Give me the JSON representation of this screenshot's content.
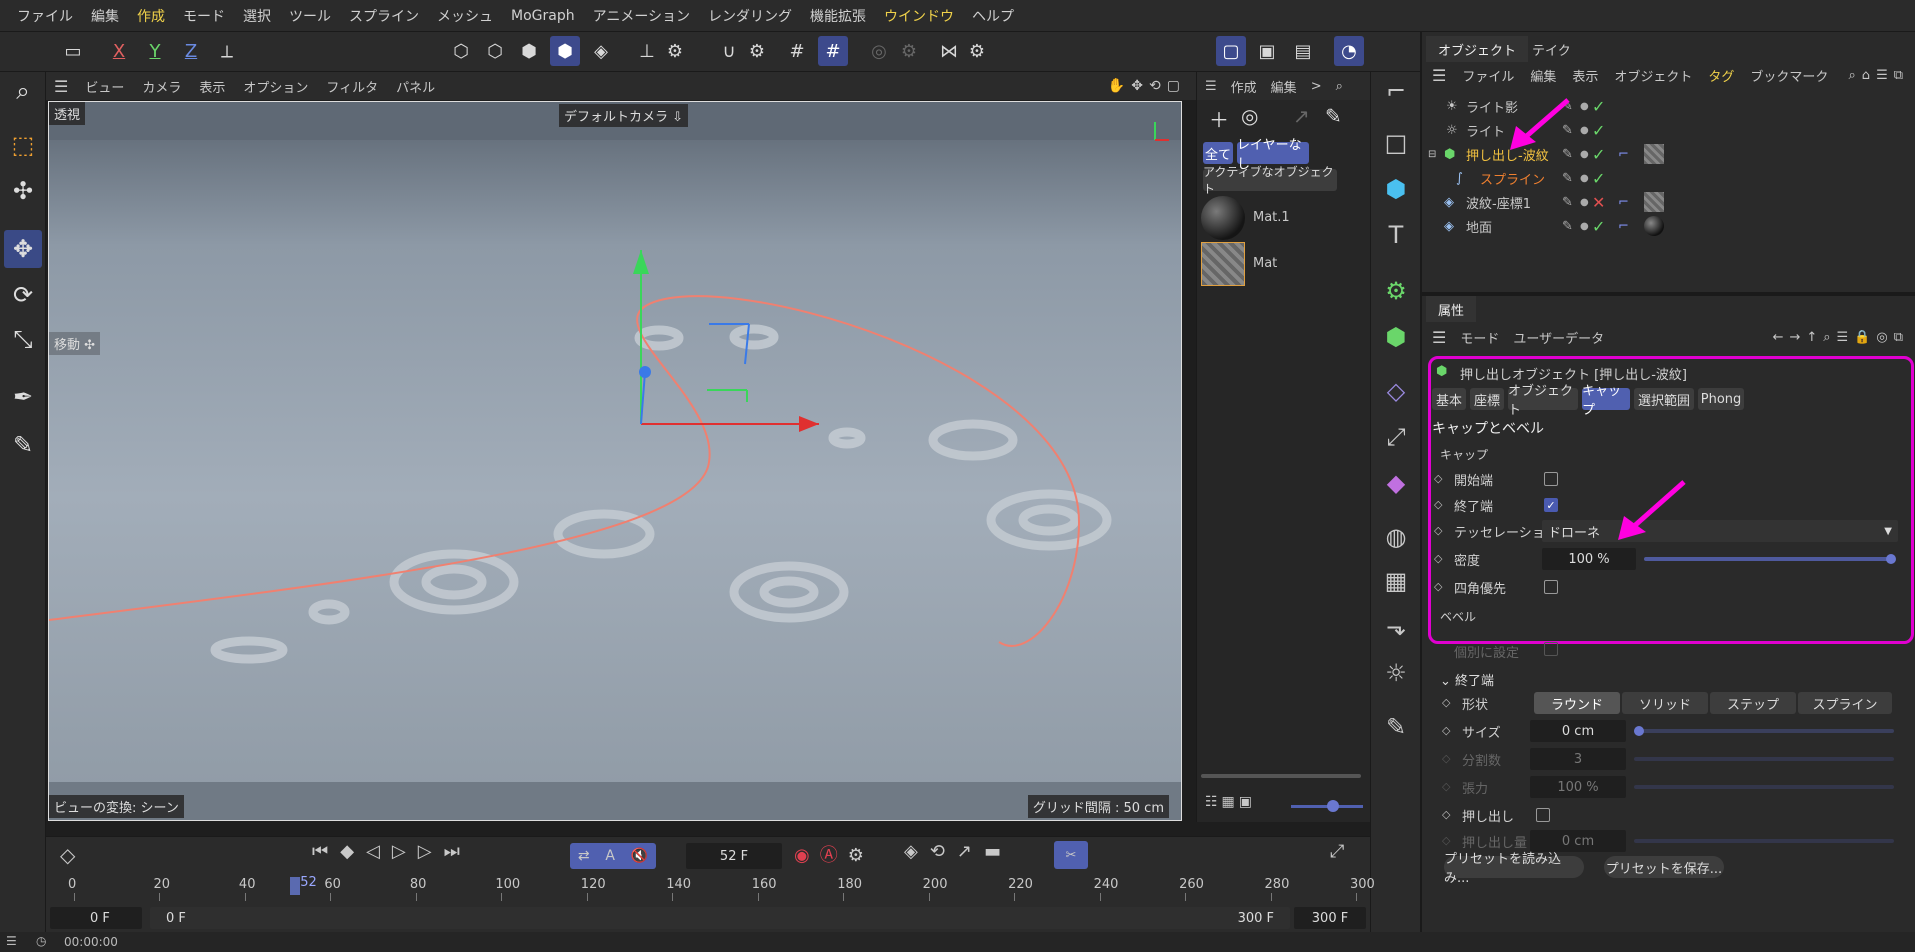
{
  "menu": [
    "ファイル",
    "編集",
    "作成",
    "モード",
    "選択",
    "ツール",
    "スプライン",
    "メッシュ",
    "MoGraph",
    "アニメーション",
    "レンダリング",
    "機能拡張",
    "ウインドウ",
    "ヘルプ"
  ],
  "toolbar": {
    "x": "X",
    "y": "Y",
    "z": "Z"
  },
  "view_menu": [
    "ビュー",
    "カメラ",
    "表示",
    "オプション",
    "フィルタ",
    "パネル"
  ],
  "viewport": {
    "projection": "透視",
    "camera": "デフォルトカメラ ⇩",
    "move_label": "移動 ✣",
    "transform": "ビューの変換: シーン",
    "grid": "グリッド間隔 : 50 cm"
  },
  "material_panel": {
    "menu": [
      "作成",
      "編集",
      ">"
    ],
    "all_btn": "全て",
    "layer_btn": "レイヤーなし",
    "active_btn": "アクティブなオブジェクト",
    "materials": [
      "Mat.1",
      "Mat"
    ]
  },
  "object_panel": {
    "tabs": [
      "オブジェクト",
      "テイク"
    ],
    "menu": [
      "ファイル",
      "編集",
      "表示",
      "オブジェクト",
      "タグ",
      "ブックマーク"
    ],
    "rows": [
      {
        "name": "ライト影",
        "status": "check"
      },
      {
        "name": "ライト",
        "status": "check"
      },
      {
        "name": "押し出し-波紋",
        "status": "check"
      },
      {
        "name": "スプライン",
        "status": "check"
      },
      {
        "name": "波紋-座標1",
        "status": "x"
      },
      {
        "name": "地面",
        "status": "check"
      }
    ]
  },
  "attributes": {
    "tab": "属性",
    "menu": [
      "モード",
      "ユーザーデータ"
    ],
    "object_title": "押し出しオブジェクト [押し出し-波紋]",
    "tabs": [
      "基本",
      "座標",
      "オブジェクト",
      "キャップ",
      "選択範囲",
      "Phong"
    ],
    "section": "キャップとベベル",
    "cap_group": "キャップ",
    "start_cap": "開始端",
    "end_cap": "終了端",
    "tessellation_label": "テッセレーション",
    "tessellation_value": "ドローネ",
    "density_label": "密度",
    "density_value": "100 %",
    "density_level": 1.0,
    "quad_label": "四角優先",
    "bevel_group": "ベベル",
    "individual": "個別に設定",
    "end_section": "終了端",
    "shape_label": "形状",
    "shape_options": [
      "ラウンド",
      "ソリッド",
      "ステップ",
      "スプライン"
    ],
    "size_label": "サイズ",
    "size_value": "0 cm",
    "subdiv_label": "分割数",
    "subdiv_value": "3",
    "tension_label": "張力",
    "tension_value": "100 %",
    "extrude_label": "押し出し",
    "extrude_amount_label": "押し出し量",
    "extrude_amount_value": "0 cm",
    "load_preset": "プリセットを読み込み...",
    "save_preset": "プリセットを保存..."
  },
  "timeline": {
    "frame": "52 F",
    "ticks": [
      "0",
      "20",
      "40",
      "60",
      "80",
      "100",
      "120",
      "140",
      "160",
      "180",
      "200",
      "220",
      "240",
      "260",
      "280",
      "300"
    ],
    "marker": "52",
    "start1": "0 F",
    "start2": "0 F",
    "end1": "300 F",
    "end2": "300 F"
  },
  "status": {
    "time": "00:00:00"
  },
  "colors": {
    "accent": "#5060b0",
    "magenta": "#ff00e0",
    "check": "#6ad66a"
  }
}
